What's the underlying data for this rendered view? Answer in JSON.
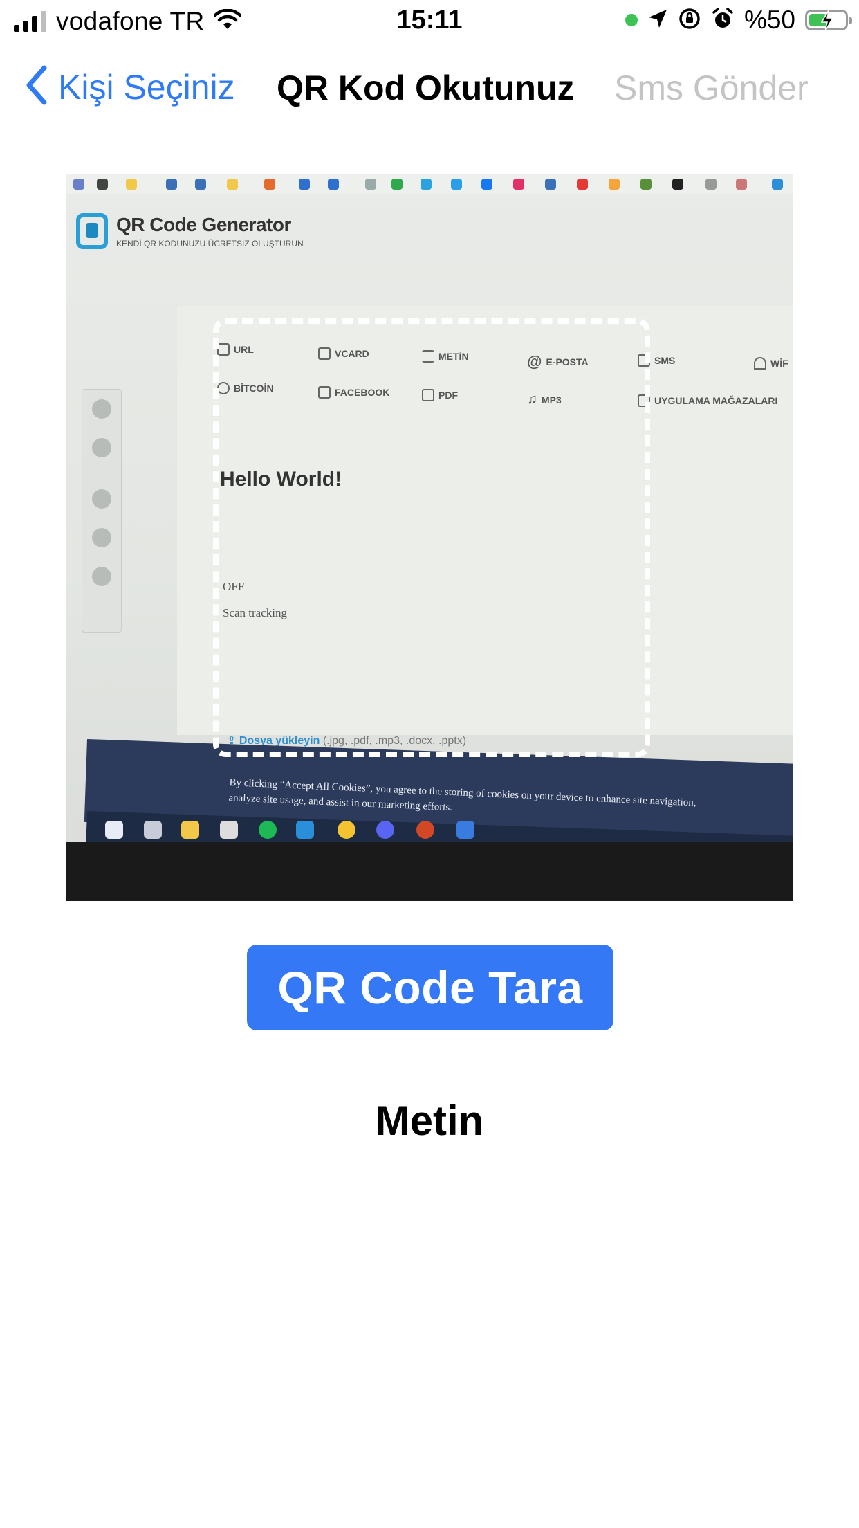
{
  "status_bar": {
    "carrier": "vodafone TR",
    "time": "15:11",
    "battery_percent": "%50",
    "battery_level": 0.5,
    "icons": [
      "signal-icon",
      "wifi-icon",
      "location-icon",
      "orientation-lock-icon",
      "alarm-icon",
      "battery-charging-icon"
    ]
  },
  "nav": {
    "back_label": "Kişi Seçiniz",
    "title": "QR Kod Okutunuz",
    "right_label": "Sms Gönder"
  },
  "camera": {
    "site_title": "QR Code Generator",
    "site_subtitle": "KENDİ QR KODUNUZU ÜCRETSİZ OLUŞTURUN",
    "types_row1": [
      "URL",
      "VCARD",
      "METİN",
      "E-POSTA",
      "SMS",
      "WİF"
    ],
    "types_row2": [
      "BİTCOİN",
      "FACEBOOK",
      "PDF",
      "MP3",
      "UYGULAMA MAĞAZALARI"
    ],
    "text_value": "Hello World!",
    "toggle_state": "OFF",
    "scan_tracking": "Scan tracking",
    "upload_link": "Dosya yükleyin",
    "upload_types": "(.jpg, .pdf, .mp3, .docx, .pptx)",
    "cookie_text": "By clicking “Accept All Cookies”, you agree to the storing of cookies on your device to enhance site navigation, analyze site usage, and assist in our marketing efforts."
  },
  "actions": {
    "scan_button": "QR Code Tara"
  },
  "result": {
    "label": "Metin"
  },
  "colors": {
    "accent": "#3478f6",
    "nav_blue": "#2f7bf5",
    "disabled_gray": "#c4c4c4",
    "battery_green": "#3fc254"
  }
}
